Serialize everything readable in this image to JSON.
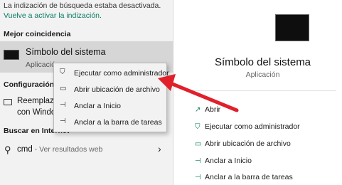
{
  "left": {
    "notice": "La indización de búsqueda estaba desactivada.",
    "notice_link": "Vuelve a activar la indización.",
    "best_match_header": "Mejor coincidencia",
    "best_match": {
      "title": "Símbolo del sistema",
      "subtitle": "Aplicación"
    },
    "config_header": "Configuración",
    "config_item_line1": "Reemplaza",
    "config_item_line2": "con Windo",
    "web_header": "Buscar en Internet",
    "web_term": "cmd",
    "web_suffix": " - Ver resultados web"
  },
  "context_menu": [
    {
      "label": "Ejecutar como administrador",
      "icon": "shield-icon"
    },
    {
      "label": "Abrir ubicación de archivo",
      "icon": "folder-icon"
    },
    {
      "label": "Anclar a Inicio",
      "icon": "pin-icon"
    },
    {
      "label": "Anclar a la barra de tareas",
      "icon": "pin-icon"
    }
  ],
  "right": {
    "title": "Símbolo del sistema",
    "subtitle": "Aplicación",
    "actions": [
      {
        "label": "Abrir",
        "icon": "open-icon"
      },
      {
        "label": "Ejecutar como administrador",
        "icon": "shield-icon"
      },
      {
        "label": "Abrir ubicación de archivo",
        "icon": "folder-icon"
      },
      {
        "label": "Anclar a Inicio",
        "icon": "pin-icon"
      },
      {
        "label": "Anclar a la barra de tareas",
        "icon": "pin-icon"
      }
    ]
  },
  "colors": {
    "accent": "#0a7a60",
    "arrow": "#e0202a",
    "menu_bg": "#f2f2f2",
    "highlight": "#d6d6d6"
  }
}
